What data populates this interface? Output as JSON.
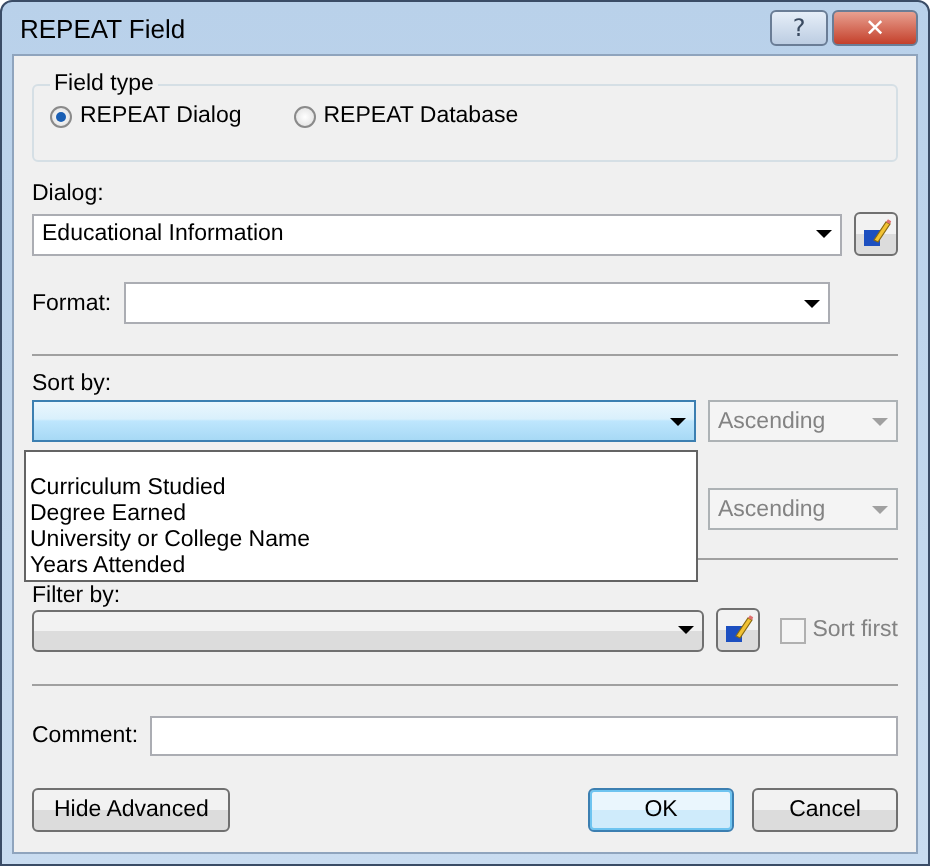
{
  "window": {
    "title": "REPEAT Field",
    "help_button": "?",
    "close_button": "✕"
  },
  "field_type": {
    "legend": "Field type",
    "options": [
      {
        "label": "REPEAT Dialog",
        "selected": true
      },
      {
        "label": "REPEAT Database",
        "selected": false
      }
    ]
  },
  "dialog": {
    "label": "Dialog:",
    "value": "Educational Information"
  },
  "format": {
    "label": "Format:"
  },
  "sort_by": {
    "label": "Sort by:",
    "focused": true,
    "order": "Ascending",
    "dropdown_items": [
      "Curriculum Studied",
      "Degree Earned",
      "University or College Name",
      "Years Attended"
    ],
    "second_order": "Ascending"
  },
  "filter_by": {
    "label": "Filter by:",
    "sort_first": {
      "label": "Sort first",
      "checked": false,
      "disabled": true
    }
  },
  "comment": {
    "label": "Comment:"
  },
  "buttons": [
    {
      "label": "Hide Advanced",
      "kind": "left",
      "default": false
    },
    {
      "label": "OK",
      "kind": "right",
      "default": true
    },
    {
      "label": "Cancel",
      "kind": "right",
      "default": false
    }
  ]
}
